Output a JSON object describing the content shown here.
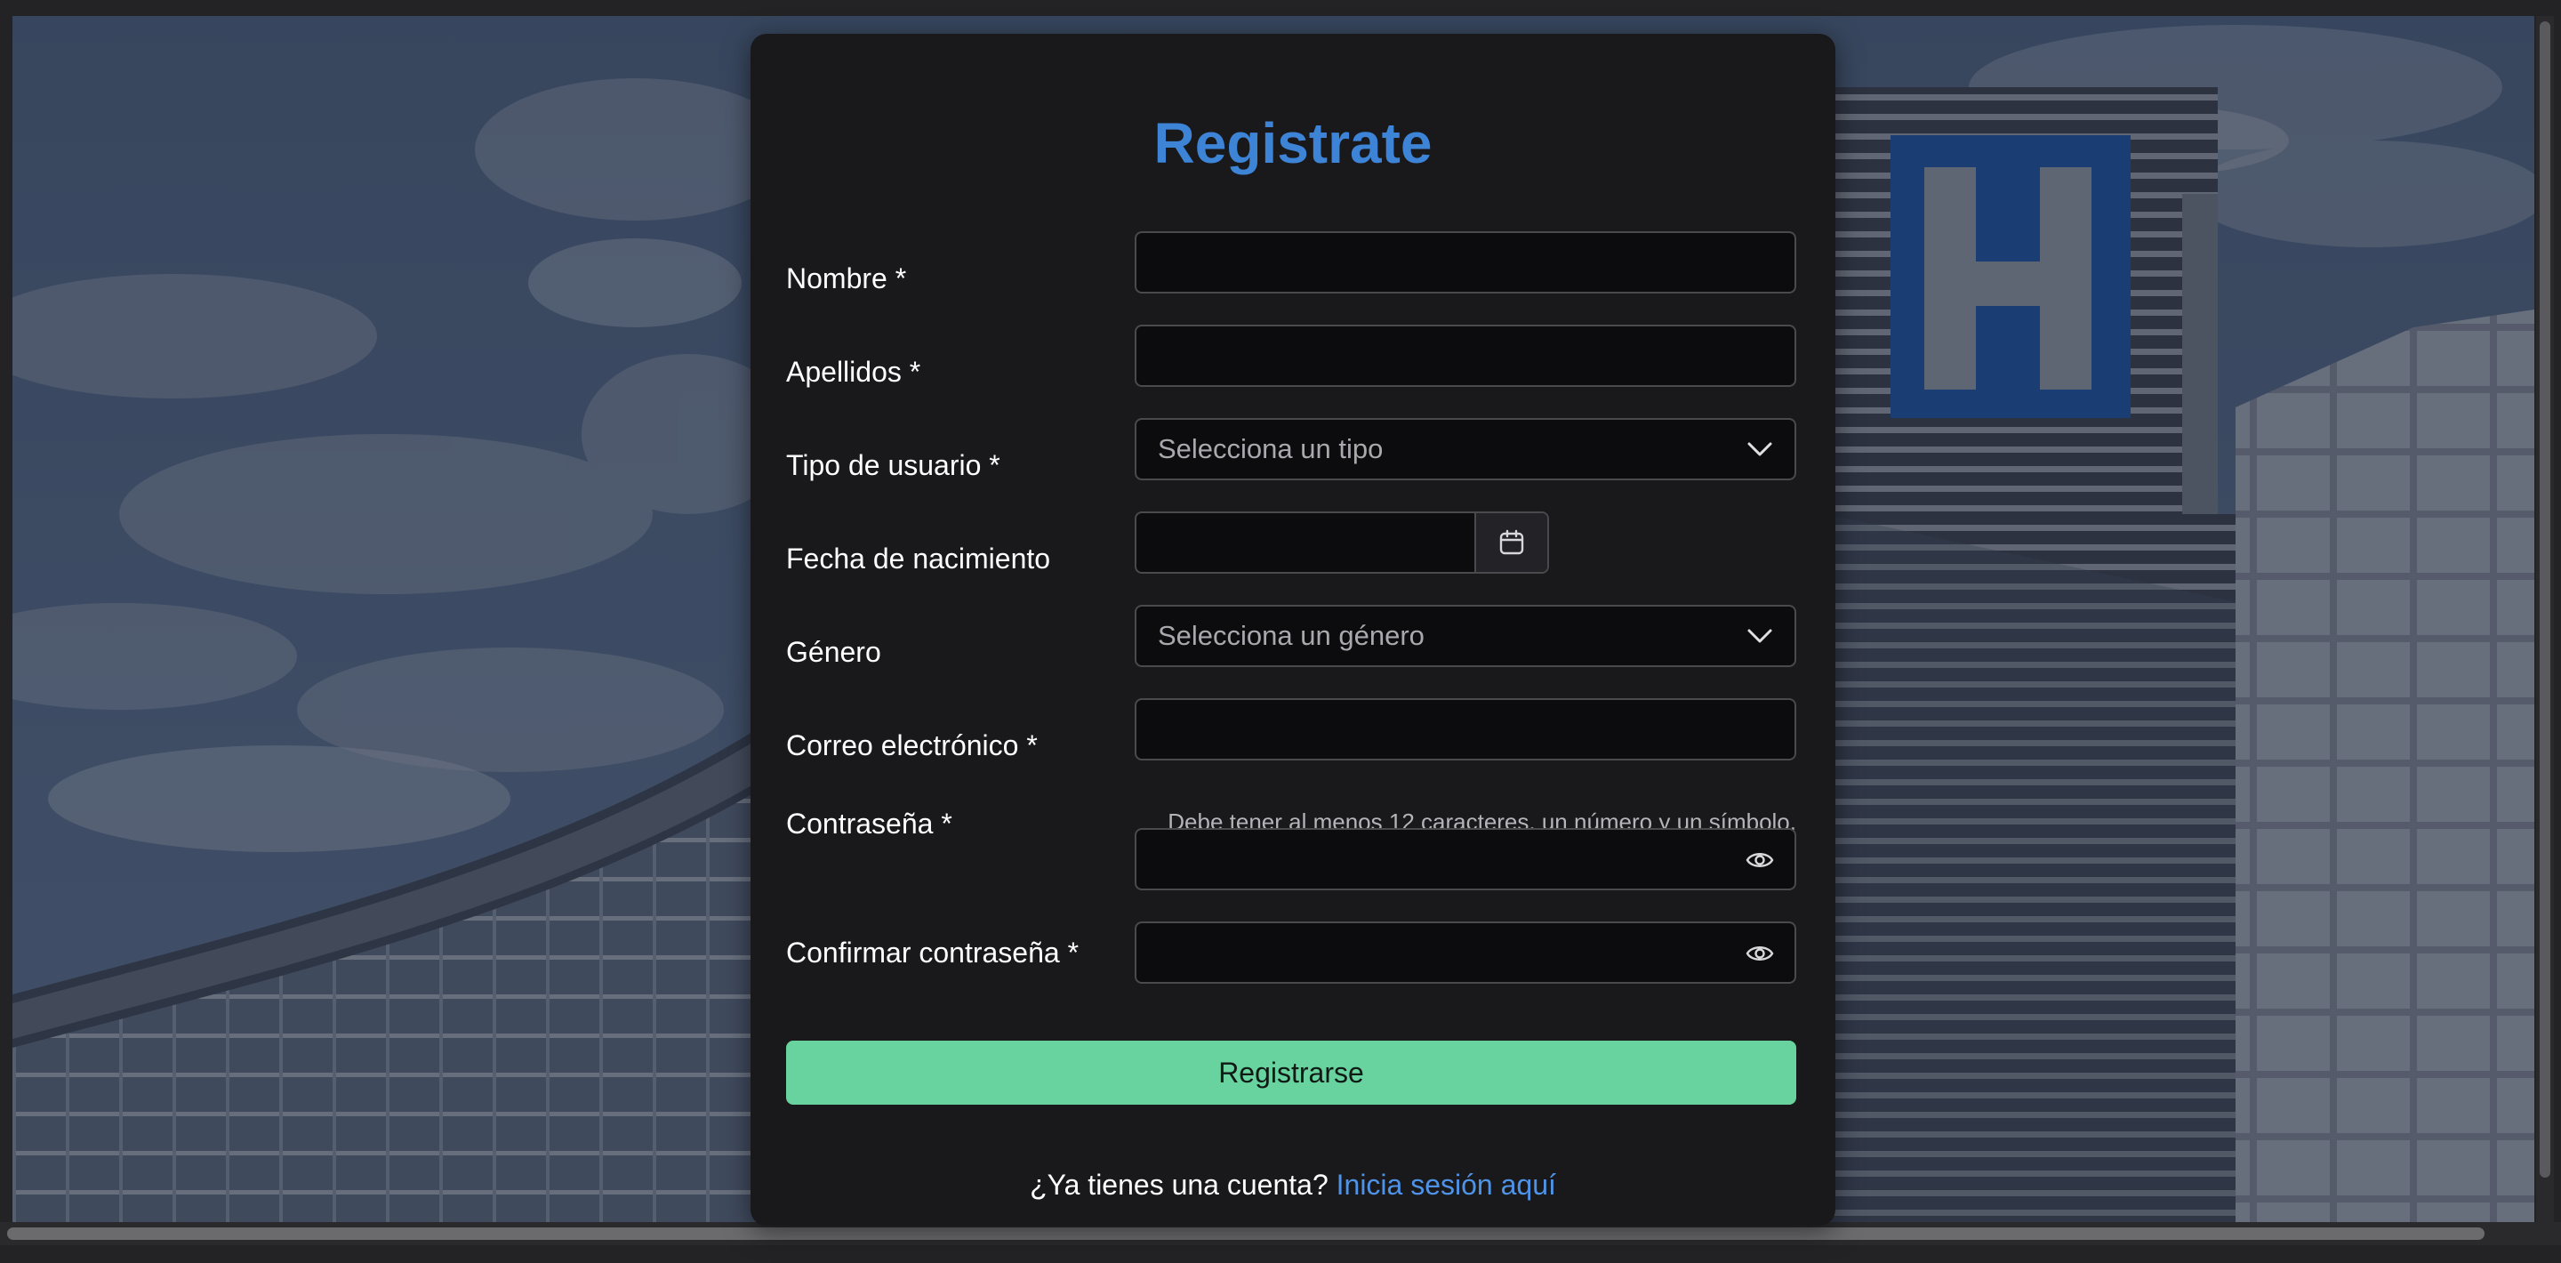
{
  "form": {
    "title": "Registrate",
    "fields": [
      {
        "label": "Nombre *",
        "value": ""
      },
      {
        "label": "Apellidos *",
        "value": ""
      },
      {
        "label": "Tipo de usuario *",
        "placeholder": "Selecciona un tipo"
      },
      {
        "label": "Fecha de nacimiento",
        "value": ""
      },
      {
        "label": "Género",
        "placeholder": "Selecciona un género"
      },
      {
        "label": "Correo electrónico *",
        "value": ""
      },
      {
        "label": "Contraseña *",
        "hint": "Debe tener al menos 12 caracteres, un número y un símbolo.",
        "value": ""
      },
      {
        "label": "Confirmar contraseña *",
        "value": ""
      }
    ],
    "submit_label": "Registrarse",
    "login_prompt": "¿Ya tienes una cuenta?",
    "login_link": "Inicia sesión aquí"
  },
  "icons": {
    "select": "chevron-down-icon",
    "date": "calendar-icon",
    "password": "eye-icon"
  },
  "colors": {
    "title": "#3d83d6",
    "submit": "#69d3a0",
    "link": "#4f93e6",
    "card": "#19191b"
  }
}
